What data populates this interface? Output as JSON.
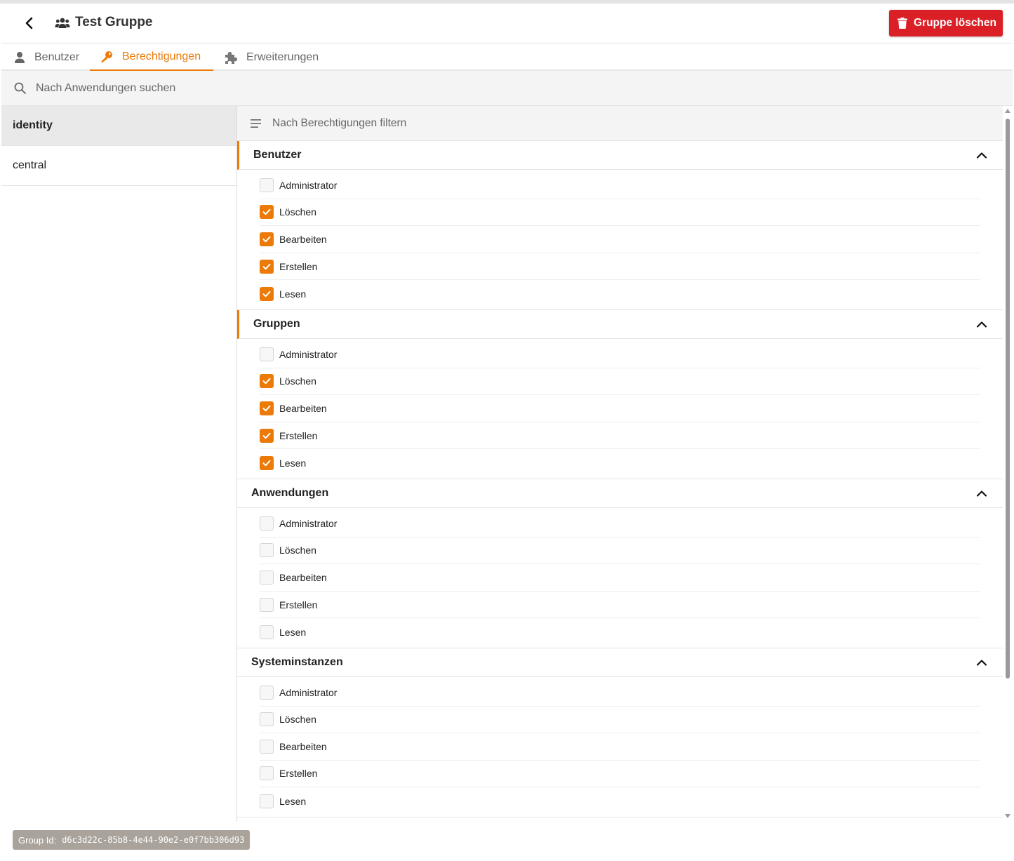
{
  "header": {
    "title": "Test Gruppe",
    "delete_label": "Gruppe löschen"
  },
  "tabs": [
    {
      "label": "Benutzer",
      "icon": "user-icon",
      "active": false
    },
    {
      "label": "Berechtigungen",
      "icon": "key-icon",
      "active": true
    },
    {
      "label": "Erweiterungen",
      "icon": "puzzle-icon",
      "active": false
    }
  ],
  "search": {
    "placeholder": "Nach Anwendungen suchen"
  },
  "apps": [
    {
      "label": "identity",
      "selected": true
    },
    {
      "label": "central",
      "selected": false
    }
  ],
  "filter": {
    "placeholder": "Nach Berechtigungen filtern"
  },
  "sections": [
    {
      "title": "Benutzer",
      "perms": [
        {
          "label": "Administrator",
          "checked": false
        },
        {
          "label": "Löschen",
          "checked": true
        },
        {
          "label": "Bearbeiten",
          "checked": true
        },
        {
          "label": "Erstellen",
          "checked": true
        },
        {
          "label": "Lesen",
          "checked": true
        }
      ]
    },
    {
      "title": "Gruppen",
      "perms": [
        {
          "label": "Administrator",
          "checked": false
        },
        {
          "label": "Löschen",
          "checked": true
        },
        {
          "label": "Bearbeiten",
          "checked": true
        },
        {
          "label": "Erstellen",
          "checked": true
        },
        {
          "label": "Lesen",
          "checked": true
        }
      ]
    },
    {
      "title": "Anwendungen",
      "perms": [
        {
          "label": "Administrator",
          "checked": false
        },
        {
          "label": "Löschen",
          "checked": false
        },
        {
          "label": "Bearbeiten",
          "checked": false
        },
        {
          "label": "Erstellen",
          "checked": false
        },
        {
          "label": "Lesen",
          "checked": false
        }
      ]
    },
    {
      "title": "Systeminstanzen",
      "perms": [
        {
          "label": "Administrator",
          "checked": false
        },
        {
          "label": "Löschen",
          "checked": false
        },
        {
          "label": "Bearbeiten",
          "checked": false
        },
        {
          "label": "Erstellen",
          "checked": false
        },
        {
          "label": "Lesen",
          "checked": false
        }
      ]
    }
  ],
  "footer": {
    "group_id_label": "Group Id:",
    "group_id_value": "d6c3d22c-85b8-4e44-90e2-e0f7bb306d93"
  },
  "colors": {
    "accent": "#ec7a08",
    "danger": "#db1f26"
  }
}
